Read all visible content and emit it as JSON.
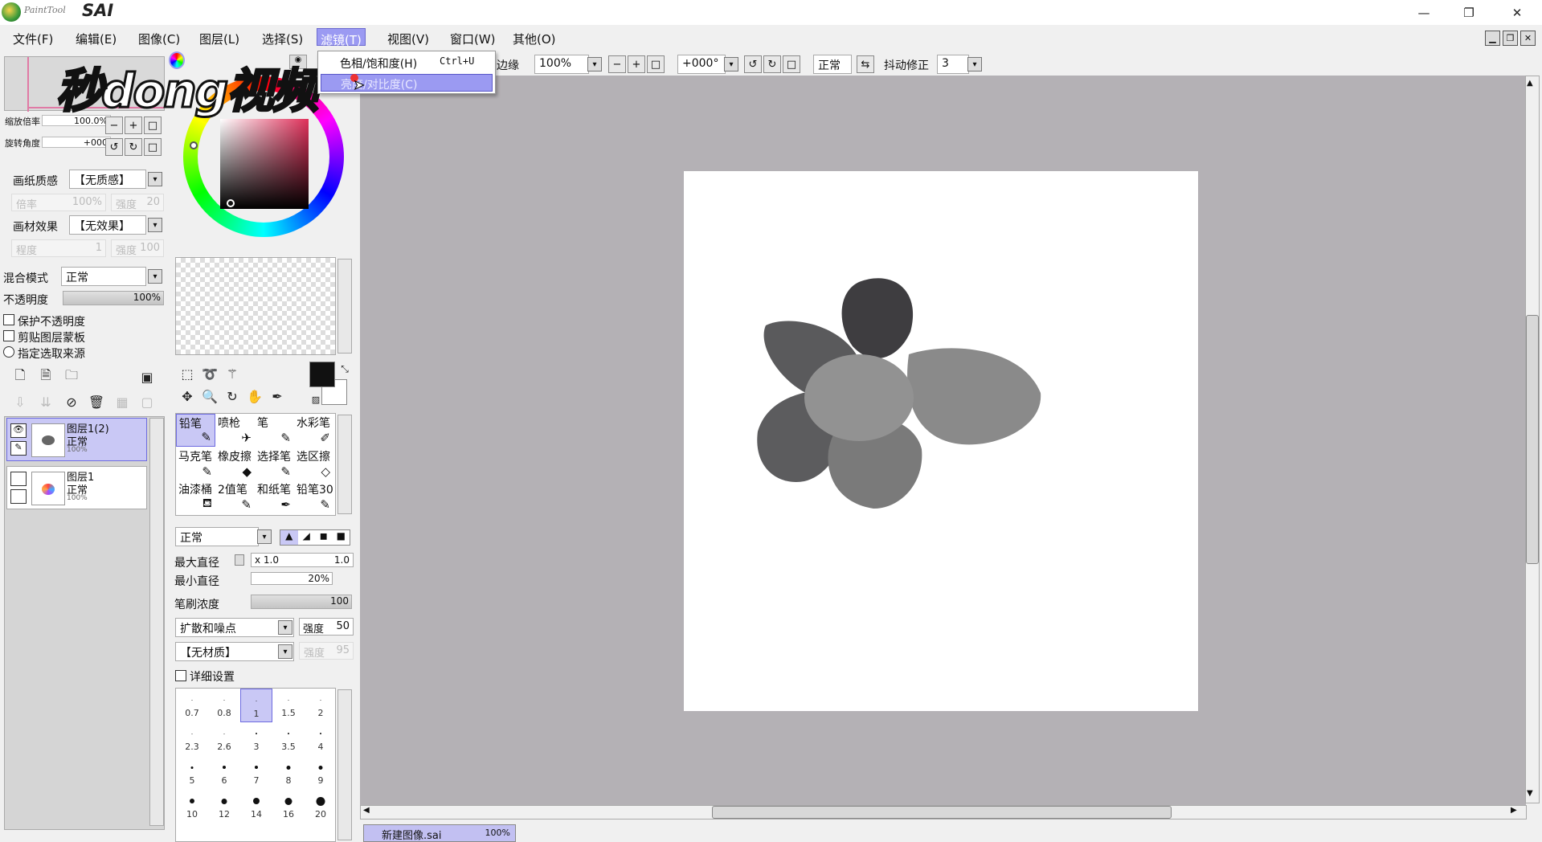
{
  "app": {
    "title_small": "PaintTool",
    "title_big": "SAI"
  },
  "window_controls": {
    "minimize": "—",
    "restore": "❐",
    "close": "✕"
  },
  "menu": [
    {
      "label": "文件(F)"
    },
    {
      "label": "编辑(E)"
    },
    {
      "label": "图像(C)"
    },
    {
      "label": "图层(L)"
    },
    {
      "label": "选择(S)"
    },
    {
      "label": "滤镜(T)"
    },
    {
      "label": "视图(V)"
    },
    {
      "label": "窗口(W)"
    },
    {
      "label": "其他(O)"
    }
  ],
  "filter_menu": {
    "items": [
      {
        "label": "色相/饱和度(H)",
        "shortcut": "Ctrl+U"
      },
      {
        "label": "亮度/对比度(C)",
        "shortcut": ""
      }
    ]
  },
  "watermark": "秒dong视频",
  "toolbar": {
    "edge_label": "边缘",
    "zoom": "100%",
    "rotation": "+000°",
    "blend": "正常",
    "stabilizer_label": "抖动修正",
    "stabilizer_value": "3"
  },
  "navigator": {
    "zoom_label": "缩放倍率",
    "zoom_value": "100.0%",
    "rotate_label": "旋转角度",
    "rotate_value": "+000"
  },
  "paper": {
    "texture_label": "画纸质感",
    "texture_value": "【无质感】",
    "texture_scale_label": "倍率",
    "texture_scale_value": "100%",
    "texture_strength_label": "强度",
    "texture_strength_value": "20",
    "effect_label": "画材效果",
    "effect_value": "【无效果】",
    "effect_level_label": "程度",
    "effect_level_value": "1",
    "effect_strength_label": "强度",
    "effect_strength_value": "100"
  },
  "layer_props": {
    "blend_label": "混合模式",
    "blend_value": "正常",
    "opacity_label": "不透明度",
    "opacity_value": "100%",
    "checks": [
      "保护不透明度",
      "剪贴图层蒙板",
      "指定选取来源"
    ]
  },
  "layers": [
    {
      "name": "图层1(2)",
      "mode": "正常",
      "opacity": "100%"
    },
    {
      "name": "图层1",
      "mode": "正常",
      "opacity": "100%"
    }
  ],
  "brushes": [
    [
      "铅笔",
      "喷枪",
      "笔",
      "水彩笔"
    ],
    [
      "马克笔",
      "橡皮擦",
      "选择笔",
      "选区擦"
    ],
    [
      "油漆桶",
      "2值笔",
      "和纸笔",
      "铅笔30"
    ]
  ],
  "brush_settings": {
    "mode": "正常",
    "max_size_label": "最大直径",
    "max_size_mult": "x 1.0",
    "max_size_value": "1.0",
    "min_size_label": "最小直径",
    "min_size_value": "20%",
    "density_label": "笔刷浓度",
    "density_value": "100",
    "shape_value": "扩散和噪点",
    "shape_strength_label": "强度",
    "shape_strength_value": "50",
    "texture_value": "【无材质】",
    "texture_strength_label": "强度",
    "texture_strength_value": "95",
    "detail_label": "详细设置"
  },
  "brush_sizes": [
    [
      "0.7",
      "0.8",
      "1",
      "1.5",
      "2"
    ],
    [
      "2.3",
      "2.6",
      "3",
      "3.5",
      "4"
    ],
    [
      "5",
      "6",
      "7",
      "8",
      "9"
    ],
    [
      "10",
      "12",
      "14",
      "16",
      "20"
    ]
  ],
  "document_tab": {
    "name": "新建图像.sai",
    "zoom": "100%"
  },
  "colors": {
    "selection": "#9b9af2",
    "canvas_bg": "#b4b1b5"
  }
}
